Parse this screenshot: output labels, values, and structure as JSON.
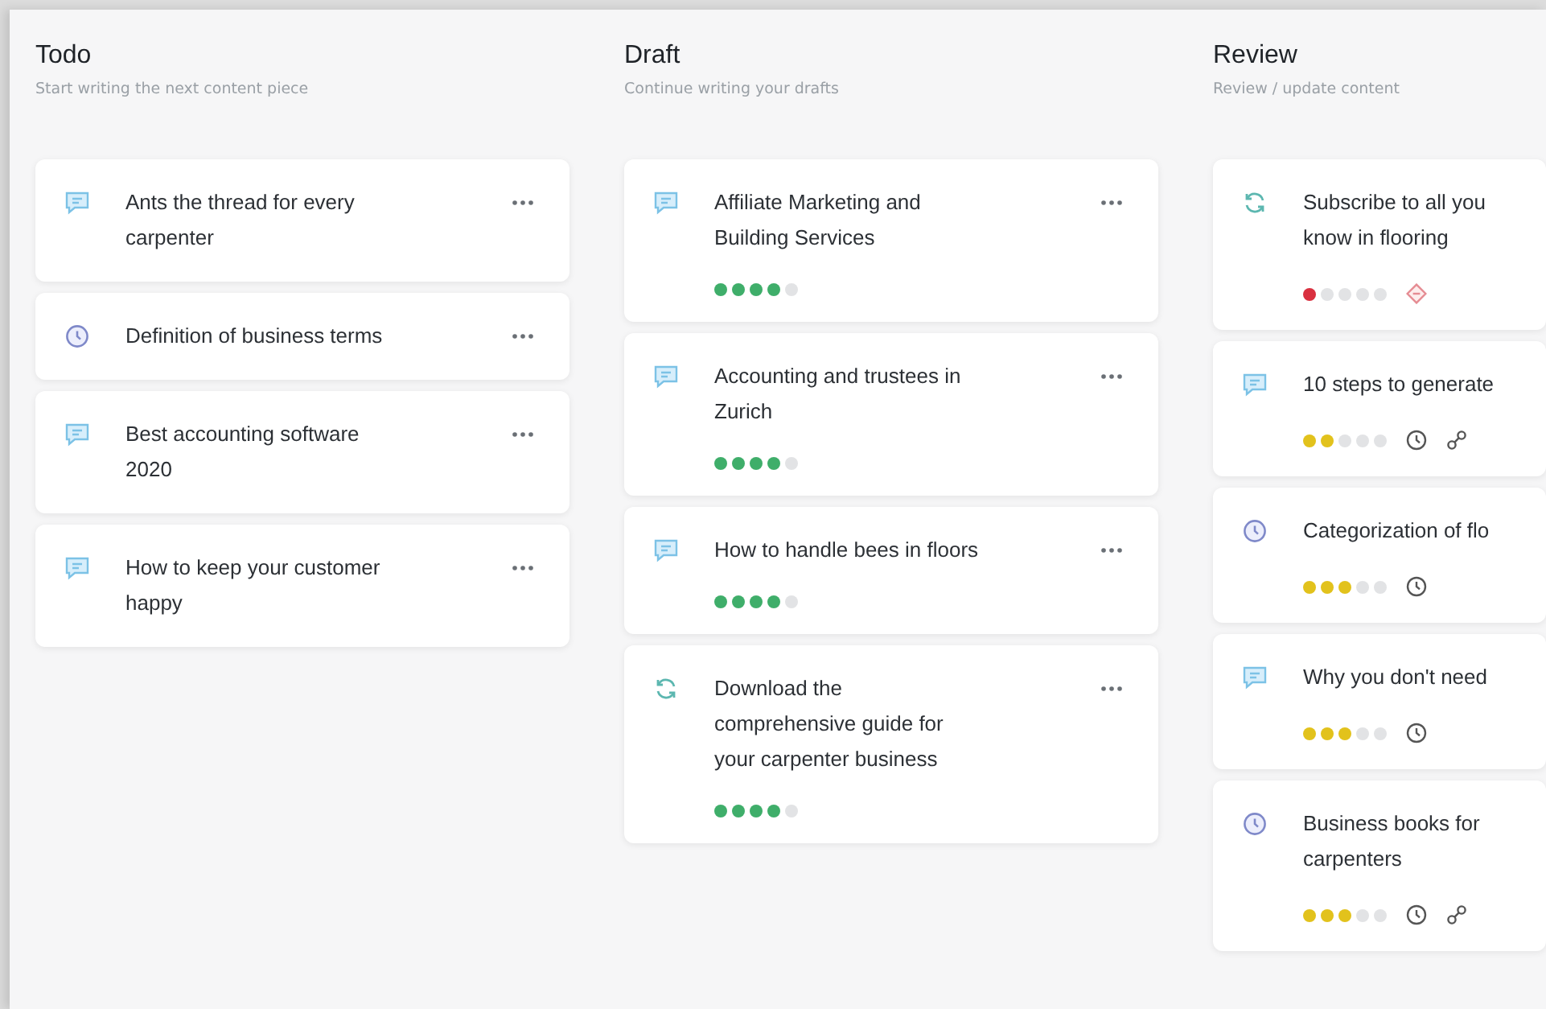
{
  "columns": [
    {
      "title": "Todo",
      "subtitle": "Start writing the next content piece",
      "show_menu": true,
      "cards": [
        {
          "kind": "chat",
          "title": "Ants the thread for every\ncarpenter"
        },
        {
          "kind": "clock",
          "title": "Definition of business terms"
        },
        {
          "kind": "chat",
          "title": "Best accounting software\n2020"
        },
        {
          "kind": "chat",
          "title": "How to keep your customer\nhappy"
        }
      ]
    },
    {
      "title": "Draft",
      "subtitle": "Continue writing your drafts",
      "show_menu": true,
      "cards": [
        {
          "kind": "chat",
          "title": "Affiliate Marketing and\nBuilding Services",
          "stars": 4,
          "color": "#3fae6a"
        },
        {
          "kind": "chat",
          "title": "Accounting and trustees in\nZurich",
          "stars": 4,
          "color": "#3fae6a"
        },
        {
          "kind": "chat",
          "title": "How to handle bees in floors",
          "stars": 4,
          "color": "#3fae6a"
        },
        {
          "kind": "sync",
          "title": "Download the\ncomprehensive guide for\nyour carpenter business",
          "stars": 4,
          "color": "#3fae6a"
        }
      ]
    },
    {
      "title": "Review",
      "subtitle": "Review / update content",
      "show_menu": false,
      "cards": [
        {
          "kind": "sync",
          "title": "Subscribe to all you\nknow in flooring",
          "stars": 1,
          "color": "#d9303f",
          "badges": [
            {
              "kind": "warning"
            }
          ]
        },
        {
          "kind": "chat",
          "title": "10 steps to generate",
          "stars": 2,
          "color": "#e2c21c",
          "badges": [
            {
              "kind": "clock"
            },
            {
              "kind": "link"
            }
          ]
        },
        {
          "kind": "clock",
          "title": "Categorization of flo",
          "stars": 3,
          "color": "#e2c21c",
          "badges": [
            {
              "kind": "clock"
            }
          ]
        },
        {
          "kind": "chat",
          "title": "Why you don't need",
          "stars": 3,
          "color": "#e2c21c",
          "badges": [
            {
              "kind": "clock"
            }
          ]
        },
        {
          "kind": "clock",
          "title": "Business books for\ncarpenters",
          "stars": 3,
          "color": "#e2c21c",
          "badges": [
            {
              "kind": "clock"
            },
            {
              "kind": "link"
            }
          ]
        }
      ]
    }
  ]
}
